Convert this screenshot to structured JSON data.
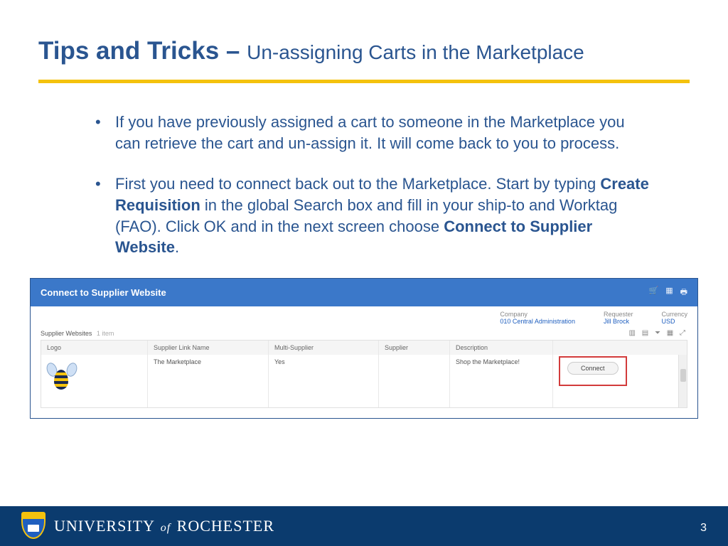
{
  "title": {
    "main": "Tips and Tricks – ",
    "sub": "Un-assigning Carts in the Marketplace"
  },
  "bullets": {
    "b1": "If you have previously assigned a cart to someone in the Marketplace you can retrieve the cart and un-assign it.  It will come back to you to process.",
    "b2a": "First you need to connect back out to the Marketplace.  Start by typing ",
    "b2b": "Create Requisition",
    "b2c": " in the global Search box and fill in your ship-to and Worktag (FAO).  Click OK and in the next screen choose ",
    "b2d": "Connect to Supplier Website",
    "b2e": "."
  },
  "shot": {
    "header_title": "Connect to Supplier Website",
    "meta": {
      "company_label": "Company",
      "company_value": "010 Central Administration",
      "requester_label": "Requester",
      "requester_value": "Jill Brock",
      "currency_label": "Currency",
      "currency_value": "USD"
    },
    "sublabel": "Supplier Websites",
    "sublabel_count": "1 item",
    "columns": {
      "logo": "Logo",
      "link": "Supplier Link Name",
      "multi": "Multi-Supplier",
      "supplier": "Supplier",
      "desc": "Description"
    },
    "row": {
      "link": "The Marketplace",
      "multi": "Yes",
      "supplier": "",
      "desc": "Shop the Marketplace!",
      "action": "Connect"
    }
  },
  "footer": {
    "university_a": "UNIVERSITY",
    "university_of": "of",
    "university_b": "ROCHESTER",
    "page": "3"
  }
}
